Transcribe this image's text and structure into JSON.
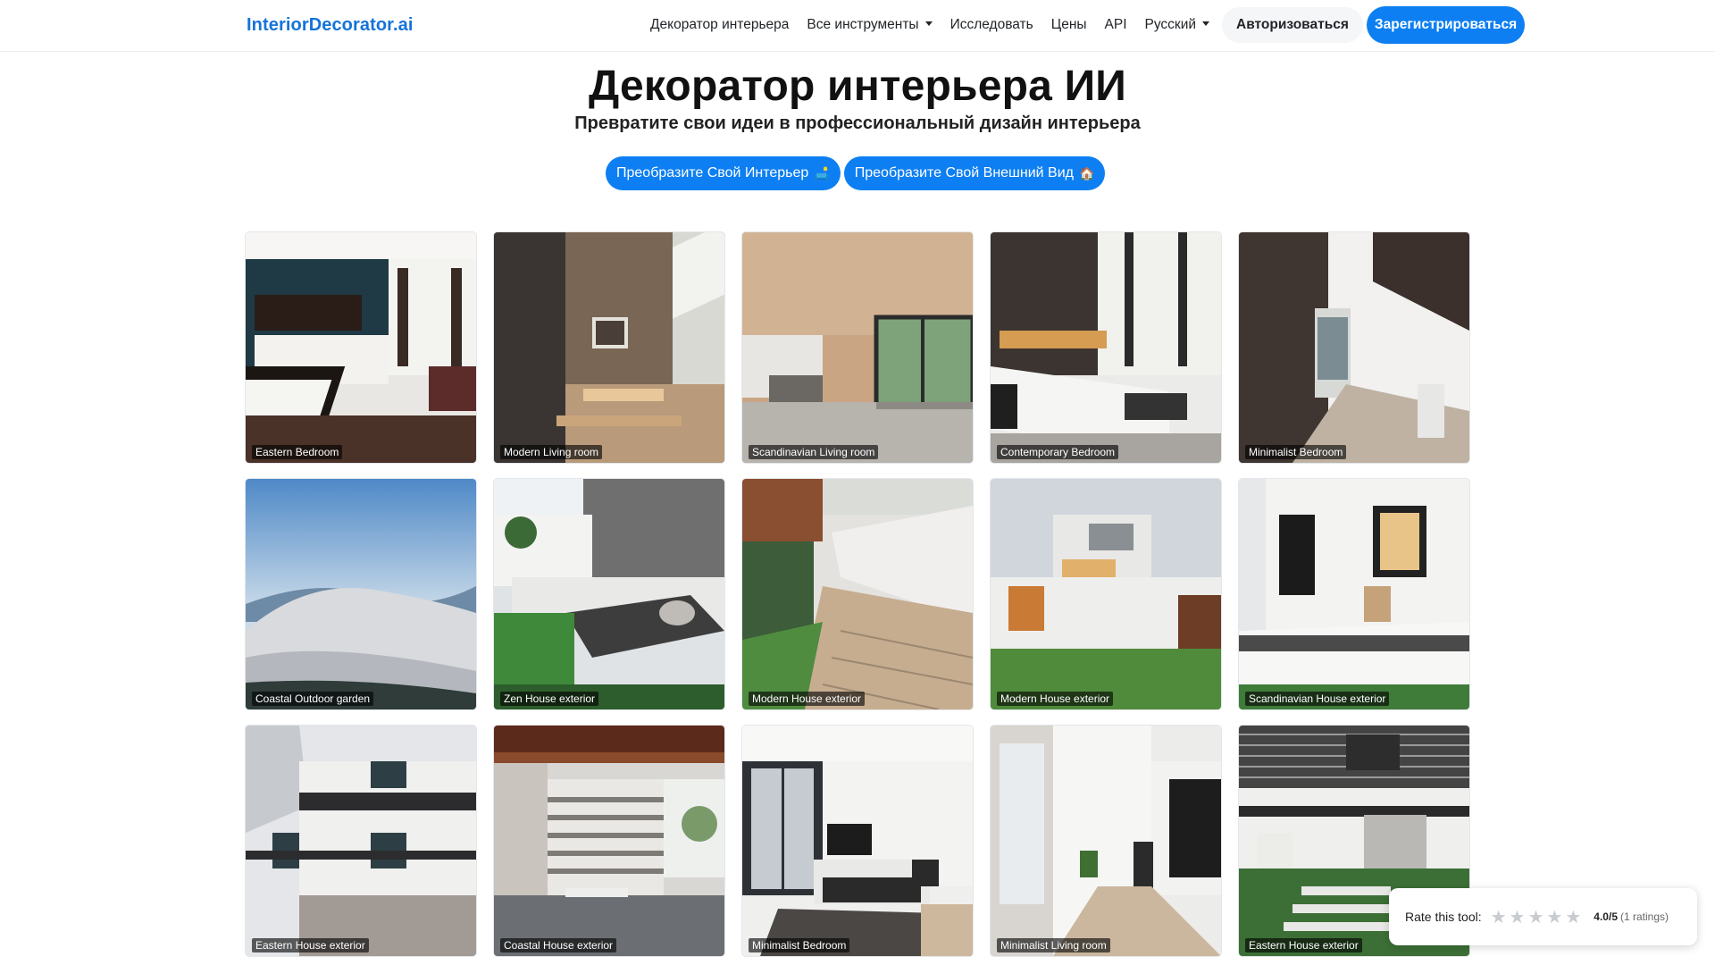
{
  "header": {
    "brand": "InteriorDecorator.ai",
    "nav": [
      {
        "label": "Декоратор интерьера",
        "dropdown": false
      },
      {
        "label": "Все инструменты",
        "dropdown": true
      },
      {
        "label": "Исследовать",
        "dropdown": false
      },
      {
        "label": "Цены",
        "dropdown": false
      },
      {
        "label": "API",
        "dropdown": false
      },
      {
        "label": "Русский",
        "dropdown": true
      }
    ],
    "login_label": "Авторизоваться",
    "signup_label": "Зарегистрироваться"
  },
  "hero": {
    "title": "Декоратор интерьера ИИ",
    "subtitle": "Превратите свои идеи в профессиональный дизайн интерьера",
    "cta_interior": "Преобразите Свой Интерьер",
    "cta_interior_icon": "🛋️",
    "cta_exterior": "Преобразите Свой Внешний Вид",
    "cta_exterior_icon": "🏠"
  },
  "gallery": [
    {
      "label": "Eastern Bedroom",
      "scene": "bedroom-dark"
    },
    {
      "label": "Modern Living room",
      "scene": "living-warm"
    },
    {
      "label": "Scandinavian Living room",
      "scene": "living-wood"
    },
    {
      "label": "Contemporary Bedroom",
      "scene": "bedroom-contemporary"
    },
    {
      "label": "Minimalist Bedroom",
      "scene": "corridor-white"
    },
    {
      "label": "Coastal Outdoor garden",
      "scene": "coastal-garden"
    },
    {
      "label": "Zen House exterior",
      "scene": "zen-exterior"
    },
    {
      "label": "Modern House exterior",
      "scene": "modern-exterior-walk"
    },
    {
      "label": "Modern House exterior",
      "scene": "modern-exterior-house"
    },
    {
      "label": "Scandinavian House exterior",
      "scene": "scandi-exterior"
    },
    {
      "label": "Eastern House exterior",
      "scene": "eastern-exterior"
    },
    {
      "label": "Coastal House exterior",
      "scene": "coastal-interior"
    },
    {
      "label": "Minimalist Bedroom",
      "scene": "minimal-bedroom"
    },
    {
      "label": "Minimalist Living room",
      "scene": "minimal-corridor"
    },
    {
      "label": "Eastern House exterior",
      "scene": "eastern-exterior-2"
    }
  ],
  "rating": {
    "label": "Rate this tool:",
    "stars_total": 5,
    "score": "4.0/5",
    "count": "(1 ratings)"
  },
  "colors": {
    "brand": "#1573d8",
    "primary_button": "#0d7ff2",
    "login_button_bg": "#f4f6f8"
  }
}
